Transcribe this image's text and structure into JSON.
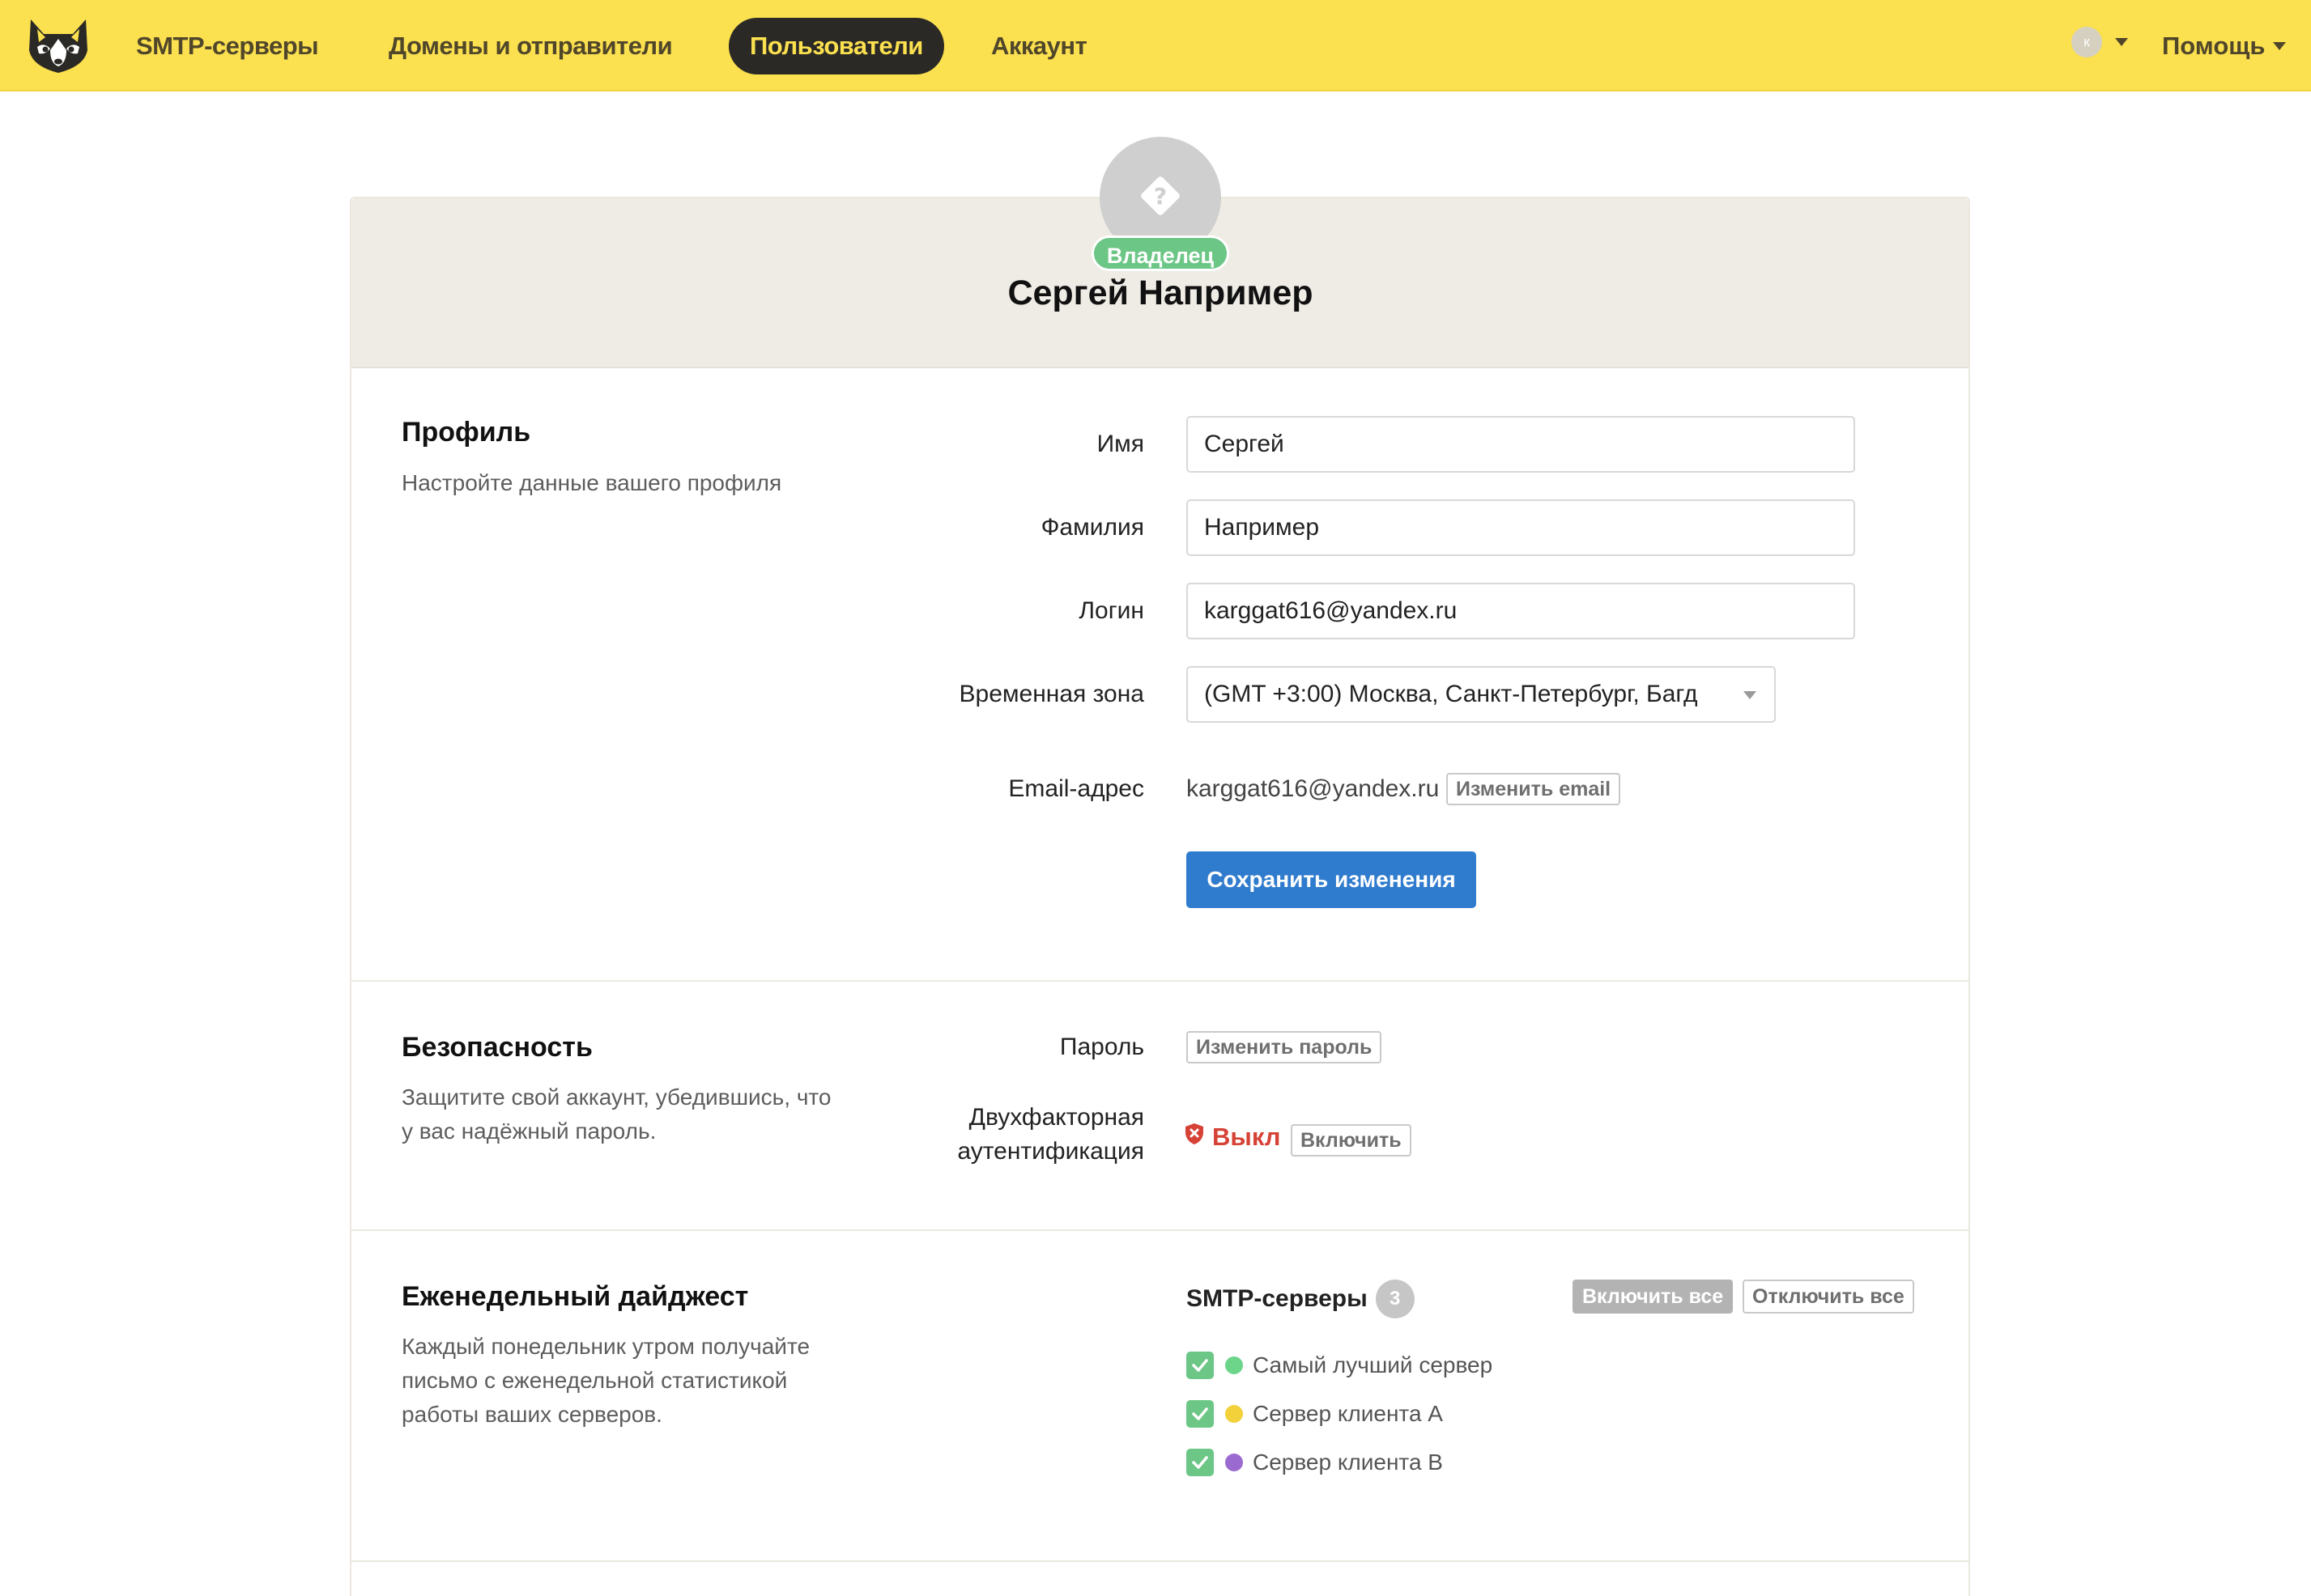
{
  "nav": {
    "items": [
      {
        "label": "SMTP-серверы"
      },
      {
        "label": "Домены и отправители"
      },
      {
        "label": "Пользователи"
      },
      {
        "label": "Аккаунт"
      }
    ],
    "user_initial": "к",
    "help_label": "Помощь"
  },
  "header": {
    "role_badge": "Владелец",
    "user_name": "Сергей Например"
  },
  "profile": {
    "title": "Профиль",
    "description": "Настройте данные вашего профиля",
    "first_name_label": "Имя",
    "first_name_value": "Сергей",
    "last_name_label": "Фамилия",
    "last_name_value": "Например",
    "login_label": "Логин",
    "login_value": "karggat616@yandex.ru",
    "timezone_label": "Временная зона",
    "timezone_value": "(GMT +3:00) Москва, Санкт-Петербург, Багд",
    "email_label": "Email-адрес",
    "email_value": "karggat616@yandex.ru",
    "change_email_label": "Изменить email",
    "save_label": "Сохранить изменения"
  },
  "security": {
    "title": "Безопасность",
    "description": "Защитите свой аккаунт, убедившись, что у вас надёжный пароль.",
    "password_label": "Пароль",
    "change_password_label": "Изменить пароль",
    "twofa_label_line1": "Двухфакторная",
    "twofa_label_line2": "аутентификация",
    "twofa_status": "Выкл",
    "enable_label": "Включить"
  },
  "digest": {
    "title": "Еженедельный дайджест",
    "description": "Каждый понедельник утром получайте письмо с еженедельной статистикой работы ваших серверов.",
    "servers_label": "SMTP-серверы",
    "servers_count": "3",
    "enable_all_label": "Включить все",
    "disable_all_label": "Отключить все",
    "servers": [
      {
        "name": "Самый лучший сервер",
        "color": "#6cd58a",
        "checked": true
      },
      {
        "name": "Сервер клиента А",
        "color": "#f2d13a",
        "checked": true
      },
      {
        "name": "Сервер клиента В",
        "color": "#9b6ad0",
        "checked": true
      }
    ]
  },
  "colors": {
    "topbar": "#fbe04f",
    "primary": "#2f7bcd",
    "success": "#6cc685",
    "danger": "#d64236"
  }
}
